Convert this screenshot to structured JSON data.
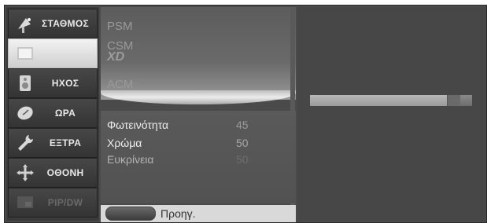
{
  "sidebar": {
    "items": [
      {
        "label": "ΣΤΑΘΜΟΣ",
        "icon": "satellite-dish-icon"
      },
      {
        "label": "",
        "icon": "picture-icon",
        "active": true
      },
      {
        "label": "ΗΧΟΣ",
        "icon": "speaker-icon"
      },
      {
        "label": "ΩΡΑ",
        "icon": "clock-icon"
      },
      {
        "label": "ΕΞΤΡΑ",
        "icon": "wrench-icon"
      },
      {
        "label": "ΟΘΟΝΗ",
        "icon": "screen-setup-icon"
      },
      {
        "label": "PIP/DW",
        "icon": "pip-icon",
        "disabled": true
      }
    ]
  },
  "submenu": {
    "items": [
      {
        "label": "PSM"
      },
      {
        "label": "CSM"
      },
      {
        "label": "XD"
      },
      {
        "label": "ACM"
      }
    ]
  },
  "settings": {
    "rows": [
      {
        "name": "Φωτεινότητα",
        "value": "45",
        "active": true
      },
      {
        "name": "Χρώμα",
        "value": "50",
        "active": true
      },
      {
        "name": "Ευκρίνεια",
        "value": "50",
        "active": false
      }
    ]
  },
  "slider": {
    "level_percent": 92
  },
  "footer": {
    "prev_label": "Προηγ."
  },
  "colors": {
    "screen_bg": "#4a4a4a",
    "active_item_bg": "#e6e6e6",
    "text_light": "#eeeeee",
    "text_dim": "#8a8a8a"
  }
}
